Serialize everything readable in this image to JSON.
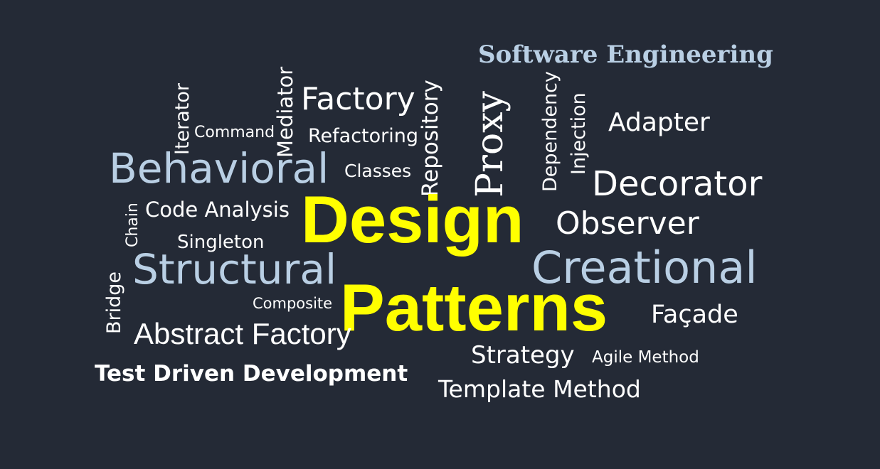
{
  "background_color": "#242a36",
  "colors": {
    "primary": "#ffff00",
    "secondary": "#b9cfe4",
    "default": "#ffffff"
  },
  "words": {
    "software_engineering": "Software Engineering",
    "iterator": "Iterator",
    "command": "Command",
    "mediator": "Mediator",
    "factory": "Factory",
    "refactoring": "Refactoring",
    "repository": "Repository",
    "proxy": "Proxy",
    "dependency": "Dependency",
    "injection": "Injection",
    "adapter": "Adapter",
    "behavioral": "Behavioral",
    "classes": "Classes",
    "decorator": "Decorator",
    "chain": "Chain",
    "code_analysis": "Code Analysis",
    "design": "Design",
    "observer": "Observer",
    "singleton": "Singleton",
    "structural": "Structural",
    "creational": "Creational",
    "bridge": "Bridge",
    "composite": "Composite",
    "patterns": "Patterns",
    "facade": "Façade",
    "abstract_factory": "Abstract Factory",
    "strategy": "Strategy",
    "agile_method": "Agile Method",
    "test_driven_development": "Test Driven Development",
    "template_method": "Template Method"
  }
}
